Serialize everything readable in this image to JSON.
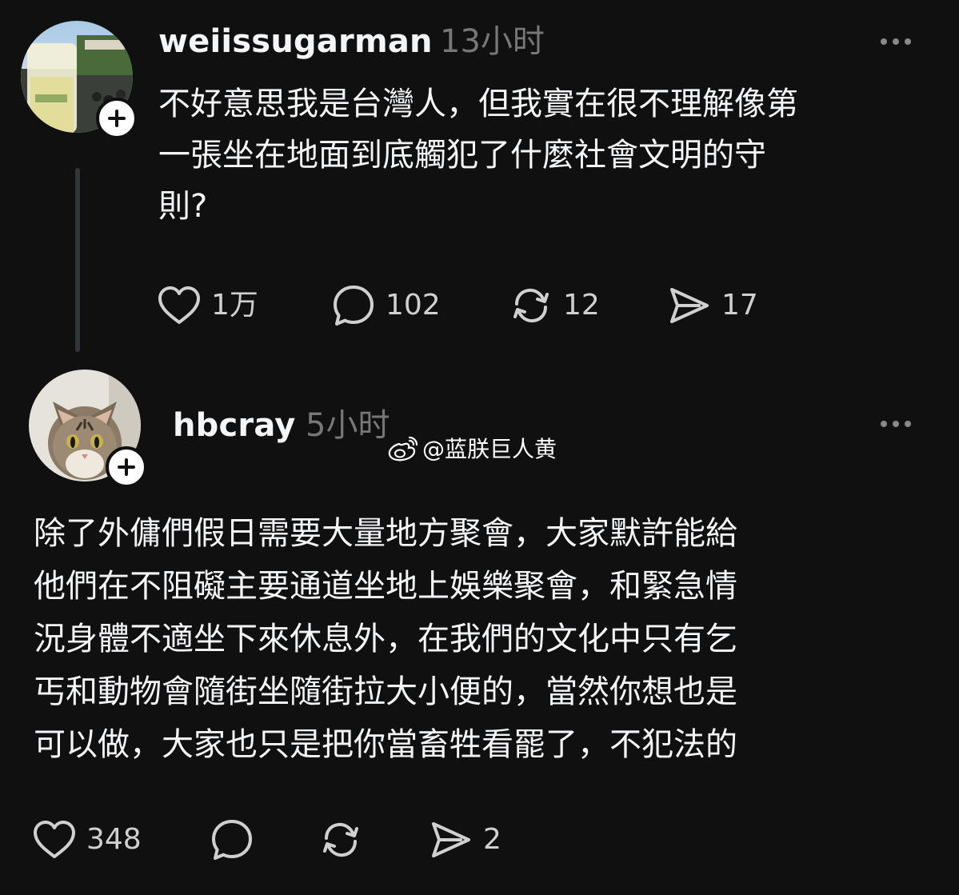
{
  "posts": [
    {
      "username": "weiissugarman",
      "time": "13小时",
      "text_lines": [
        "不好意思我是台灣人，但我實在很不理解像第",
        "一張坐在地面到底觸犯了什麼社會文明的守",
        "則?"
      ],
      "likes": "1万",
      "comments": "102",
      "reposts": "12",
      "shares": "17"
    },
    {
      "username": "hbcray",
      "time": "5小时",
      "text_lines": [
        "除了外傭們假日需要大量地方聚會，大家默許能給",
        "他們在不阻礙主要通道坐地上娛樂聚會，和緊急情",
        "況身體不適坐下來休息外，在我們的文化中只有乞",
        "丐和動物會隨街坐隨街拉大小便的，當然你想也是",
        "可以做，大家也只是把你當畜牲看罷了，不犯法的"
      ],
      "likes": "348",
      "comments": "",
      "reposts": "",
      "shares": "2"
    }
  ],
  "watermark": "@蓝朕巨人黄",
  "icons": {
    "like": "heart-icon",
    "comment": "comment-bubble-icon",
    "repost": "repost-icon",
    "share": "send-icon",
    "more": "more-options-icon",
    "follow": "plus-icon",
    "watermark_logo": "weibo-logo-icon"
  },
  "colors": {
    "background": "#101010",
    "text": "#f3f5f7",
    "secondary": "#777777",
    "thread_line": "#333638"
  }
}
